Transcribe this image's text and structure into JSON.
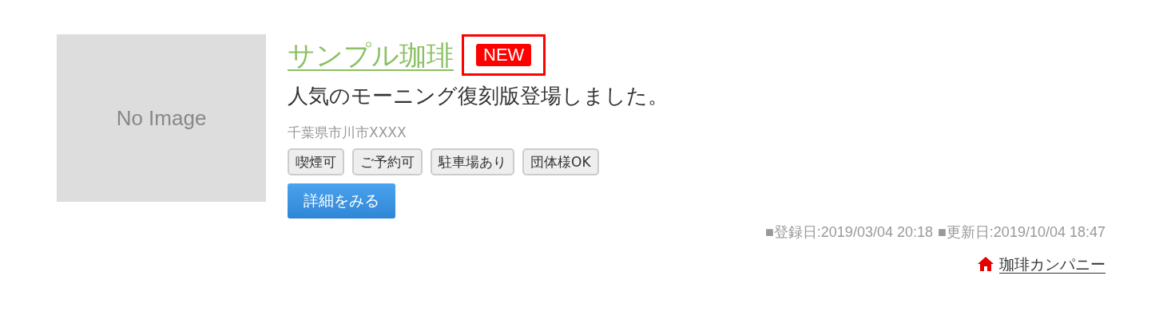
{
  "image_placeholder": {
    "text": "No Image"
  },
  "title": "サンプル珈琲",
  "badge": "NEW",
  "headline": "人気のモーニング復刻版登場しました。",
  "address": "千葉県市川市XXXX",
  "tags": [
    "喫煙可",
    "ご予約可",
    "駐車場あり",
    "団体様OK"
  ],
  "detail_button": "詳細をみる",
  "dates": [
    "■登録日:2019/03/04 20:18",
    "■更新日:2019/10/04 18:47"
  ],
  "company_link": "珈琲カンパニー"
}
